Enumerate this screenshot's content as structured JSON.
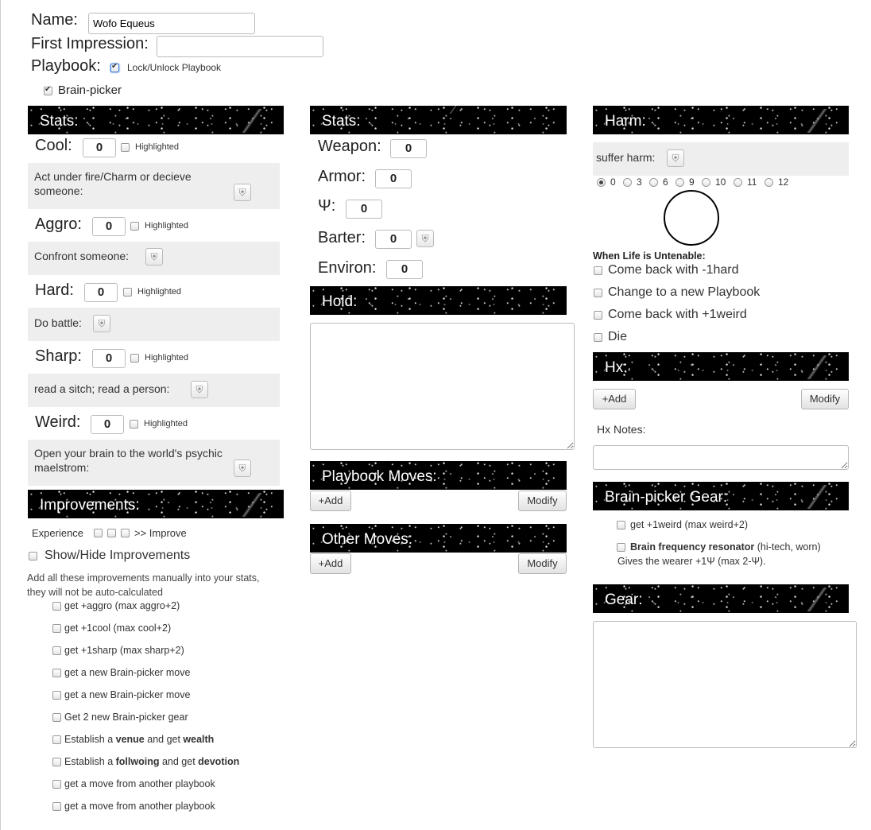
{
  "header": {
    "name_label": "Name:",
    "name_value": "Wofo Equeus",
    "first_impression_label": "First Impression:",
    "first_impression_value": "",
    "playbook_label": "Playbook:",
    "lock_label": "Lock/Unlock Playbook",
    "playbook_name": "Brain-picker"
  },
  "col1": {
    "stats_title": "Stats:",
    "stats": [
      {
        "label": "Cool:",
        "value": "0",
        "highlight": "Highlighted",
        "move": "Act under fire/Charm or decieve someone:"
      },
      {
        "label": "Aggro:",
        "value": "0",
        "highlight": "Highlighted",
        "move": "Confront someone:"
      },
      {
        "label": "Hard:",
        "value": "0",
        "highlight": "Highlighted",
        "move": "Do battle:"
      },
      {
        "label": "Sharp:",
        "value": "0",
        "highlight": "Highlighted",
        "move": "read a sitch; read a person:"
      },
      {
        "label": "Weird:",
        "value": "0",
        "highlight": "Highlighted",
        "move": "Open your brain to the world's psychic maelstrom:"
      }
    ],
    "improvements_title": "Improvements:",
    "experience_label": "Experience",
    "improve_label": ">> Improve",
    "show_hide_label": "Show/Hide Improvements",
    "improvements_note": "Add all these improvements manually into your stats, they will not be auto-calculated",
    "improvements": [
      {
        "text": "get +aggro (max aggro+2)"
      },
      {
        "text": "get +1cool (max cool+2)"
      },
      {
        "text": "get +1sharp (max sharp+2)"
      },
      {
        "text": "get a new Brain-picker move"
      },
      {
        "text": "get a new Brain-picker move"
      },
      {
        "text": "Get 2 new Brain-picker gear"
      },
      {
        "pre": "Establish a ",
        "b1": "venue",
        "mid": " and get ",
        "b2": "wealth"
      },
      {
        "pre": "Establish a ",
        "b1": "follwoing",
        "mid": " and get ",
        "b2": "devotion"
      },
      {
        "text": "get a move from another playbook"
      },
      {
        "text": "get a move from another playbook"
      }
    ]
  },
  "col2": {
    "stats_title": "Stats:",
    "stats": [
      {
        "label": "Weapon:",
        "value": "0"
      },
      {
        "label": "Armor:",
        "value": "0"
      },
      {
        "label": "Ψ:",
        "value": "0"
      },
      {
        "label": "Barter:",
        "value": "0"
      },
      {
        "label": "Environ:",
        "value": "0"
      }
    ],
    "hold_title": "Hold:",
    "playbook_moves_title": "Playbook Moves:",
    "other_moves_title": "Other Moves:",
    "add_label": "+Add",
    "modify_label": "Modify"
  },
  "col3": {
    "harm_title": "Harm:",
    "suffer_harm_label": "suffer harm:",
    "harm_options": [
      "0",
      "3",
      "6",
      "9",
      "10",
      "11",
      "12"
    ],
    "harm_selected": "0",
    "untenable_title": "When Life is Untenable:",
    "untenable_options": [
      "Come back with -1hard",
      "Change to a new Playbook",
      "Come back with +1weird",
      "Die"
    ],
    "hx_title": "Hx:",
    "add_label": "+Add",
    "modify_label": "Modify",
    "hx_notes_label": "Hx Notes:",
    "gear_title": "Brain-picker Gear:",
    "gear_items": {
      "item1": "get +1weird (max weird+2)",
      "item2_bold": "Brain frequency resonator",
      "item2_rest": " (hi-tech, worn)",
      "item2_desc": "Gives the wearer +1Ψ (max 2-Ψ)."
    },
    "gear_box_title": "Gear:"
  },
  "icons": {
    "roll": "dice-roll-icon",
    "check": "checkmark-icon",
    "streak": "star-streak-icon"
  }
}
